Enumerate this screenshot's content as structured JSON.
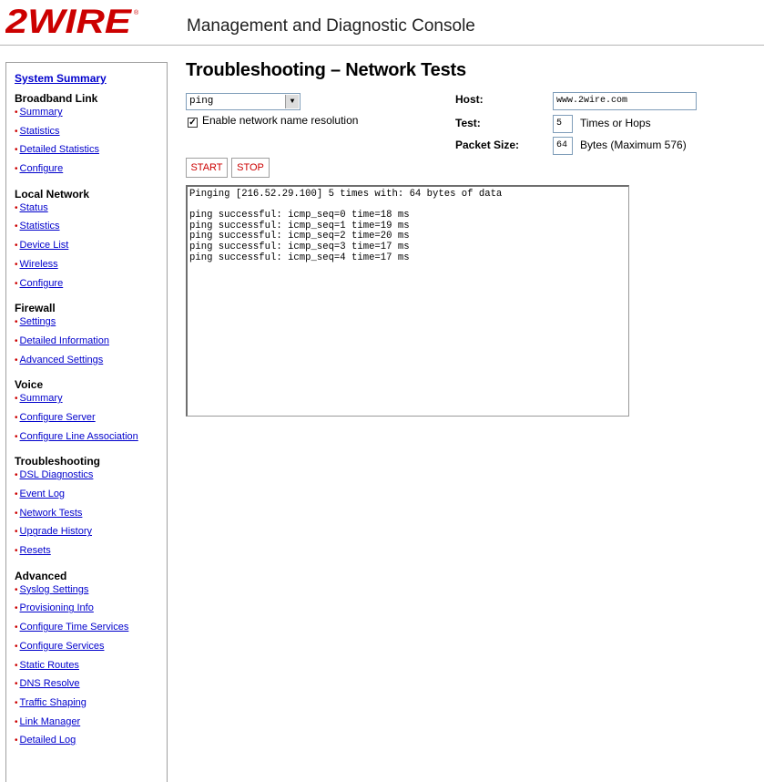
{
  "header": {
    "logo_text": "2WIRE",
    "title": "Management and Diagnostic Console"
  },
  "sidebar": {
    "summary_label": "System Summary",
    "sections": [
      {
        "heading": "Broadband Link",
        "items": [
          "Summary",
          "Statistics",
          "Detailed Statistics",
          "Configure"
        ]
      },
      {
        "heading": "Local Network",
        "items": [
          "Status",
          "Statistics",
          "Device List",
          "Wireless",
          "Configure"
        ]
      },
      {
        "heading": "Firewall",
        "items": [
          "Settings",
          "Detailed Information",
          "Advanced Settings"
        ]
      },
      {
        "heading": "Voice",
        "items": [
          "Summary",
          "Configure Server",
          "Configure Line Association"
        ]
      },
      {
        "heading": "Troubleshooting",
        "items": [
          "DSL Diagnostics",
          "Event Log",
          "Network Tests",
          "Upgrade History",
          "Resets"
        ]
      },
      {
        "heading": "Advanced",
        "items": [
          "Syslog Settings",
          "Provisioning Info",
          "Configure Time Services",
          "Configure Services",
          "Static Routes",
          "DNS Resolve",
          "Traffic Shaping",
          "Link Manager",
          "Detailed Log"
        ]
      }
    ]
  },
  "main": {
    "page_title": "Troubleshooting – Network Tests",
    "test_type": "ping",
    "enable_resolution_label": "Enable network name resolution",
    "enable_resolution_checked": true,
    "host_label": "Host:",
    "host_value": "www.2wire.com",
    "test_label": "Test:",
    "test_value": "5",
    "test_unit": "Times or Hops",
    "packet_label": "Packet Size:",
    "packet_value": "64",
    "packet_unit": "Bytes (Maximum 576)",
    "start_label": "START",
    "stop_label": "STOP",
    "output_text": "Pinging [216.52.29.100] 5 times with: 64 bytes of data\n\nping successful: icmp_seq=0 time=18 ms\nping successful: icmp_seq=1 time=19 ms\nping successful: icmp_seq=2 time=20 ms\nping successful: icmp_seq=3 time=17 ms\nping successful: icmp_seq=4 time=17 ms"
  },
  "colors": {
    "logo_red": "#cc0000",
    "link_blue": "#0000cc",
    "button_text_red": "#cc0000"
  }
}
